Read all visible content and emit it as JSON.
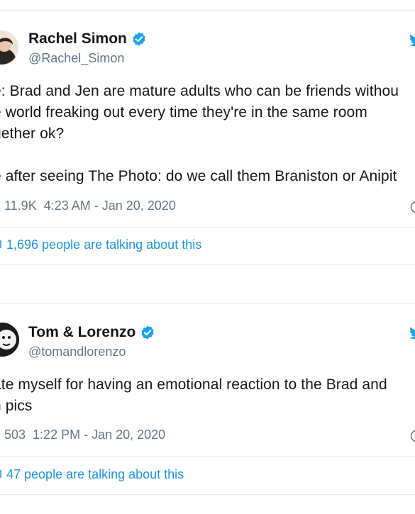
{
  "tweets": [
    {
      "author_name": "Rachel Simon",
      "handle": "@Rachel_Simon",
      "verified": true,
      "lines": [
        "e: Brad and Jen are mature adults who can be friends withou",
        "e world freaking out every time they're in the same room",
        "gether ok?",
        "e after seeing The Photo: do we call them Braniston or Anipit"
      ],
      "likes": "11.9K",
      "timestamp": "4:23 AM - Jan 20, 2020",
      "talking": "1,696 people are talking about this"
    },
    {
      "author_name": "Tom & Lorenzo",
      "handle": "@tomandlorenzo",
      "verified": true,
      "lines": [
        "ate myself for having an emotional reaction to the Brad and",
        "n pics"
      ],
      "likes": "503",
      "timestamp": "1:22 PM - Jan 20, 2020",
      "talking": "47 people are talking about this"
    }
  ],
  "colors": {
    "verified_blue": "#1da1f2",
    "link_blue": "#1b95e0",
    "secondary_text": "#657786",
    "border": "#e6ecf0"
  },
  "icons": {
    "verified": "verified-badge-icon",
    "logo": "twitter-bird-icon",
    "like": "heart-icon",
    "info": "info-icon",
    "talking": "speech-bubble-icon"
  }
}
